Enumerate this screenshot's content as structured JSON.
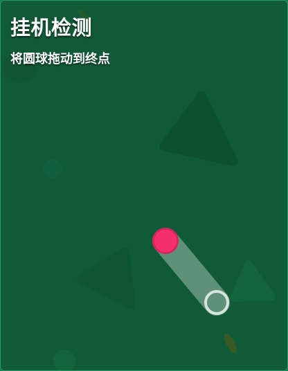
{
  "header": {
    "title": "挂机检测",
    "instruction": "将圆球拖动到终点"
  },
  "colors": {
    "background": "#115a37",
    "border": "#21a064",
    "ball": "#f5306f",
    "track": "#ffffff"
  }
}
